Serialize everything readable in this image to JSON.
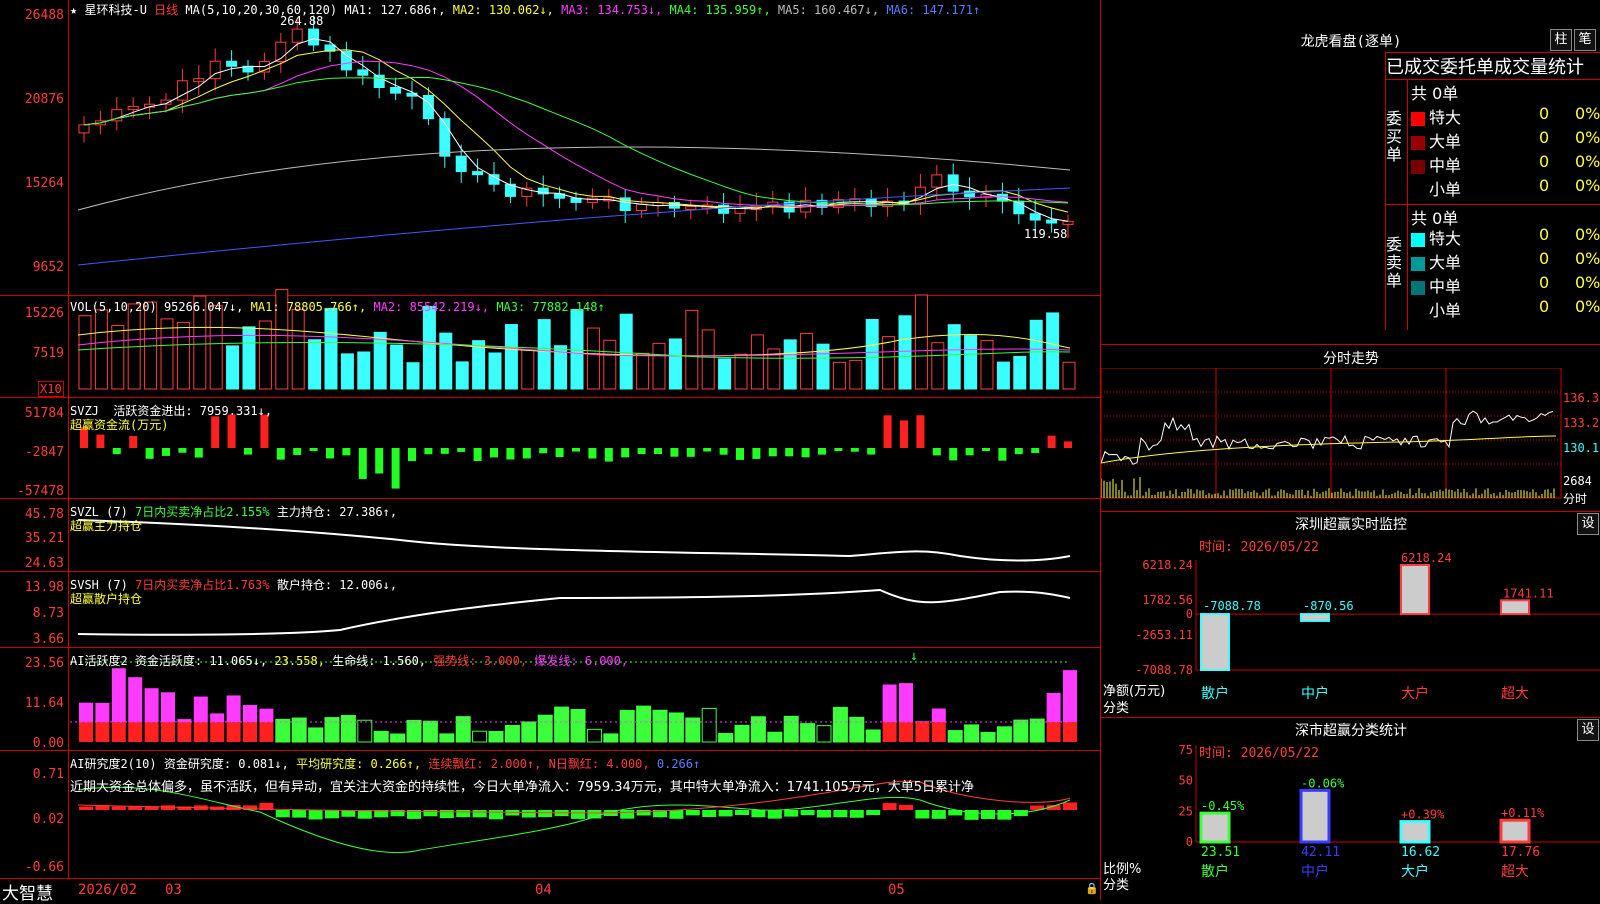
{
  "kline": {
    "title_star": "★",
    "stock_name": "星环科技-U",
    "period": "日线",
    "ma_params": "MA(5,10,20,30,60,120)",
    "ma1": "MA1: 127.686↑,",
    "ma2": "MA2: 130.062↓,",
    "ma3": "MA3: 134.753↓,",
    "ma4": "MA4: 135.959↑,",
    "ma5": "MA5: 160.467↓,",
    "ma6": "MA6: 147.171↑",
    "axis": [
      "26488",
      "20876",
      "15264",
      "9652"
    ],
    "high_label": "264.88",
    "low_label": "119.58"
  },
  "vol": {
    "params": "VOL(5,10,20)",
    "value": "95266.047↓,",
    "ma1": "MA1: 78805.766↑,",
    "ma2": "MA2: 85542.219↓,",
    "ma3": "MA3: 77882.148↑",
    "axis": [
      "15226",
      "7519"
    ],
    "unit": "X10"
  },
  "svzj": {
    "name": "SVZJ",
    "line1": "活跃资金进出: 7959.331↓,",
    "line2": "超赢资金流(万元)",
    "axis": [
      "51784",
      "-2847",
      "-57478"
    ]
  },
  "svzl": {
    "name": "SVZL (7)",
    "pct": "7日内买卖净占比2.155%",
    "hold": "主力持仓: 27.386↑,",
    "line2": "超赢主力持仓",
    "axis": [
      "45.78",
      "35.21",
      "24.63"
    ]
  },
  "svsh": {
    "name": "SVSH (7)",
    "pct": "7日内买卖净占比1.763%",
    "hold": "散户持仓: 12.006↓,",
    "line2": "超赢散户持仓",
    "axis": [
      "13.98",
      "8.73",
      "3.66"
    ]
  },
  "ai_active": {
    "name": "AI活跃度2",
    "v1": "资金活跃度: 11.065↓,",
    "v2": "23.558,",
    "v3": "生命线: 1.560,",
    "v4": "强势线: 3.000,",
    "v5": "爆发线: 6.000,",
    "axis": [
      "23.56",
      "11.64",
      "0.00"
    ]
  },
  "ai_research": {
    "name": "AI研究度2(10)",
    "v1": "资金研究度: 0.081↓,",
    "v2": "平均研究度: 0.266↑,",
    "v3": "连续飘红: 2.000↑,",
    "v4": "N日飘红: 4.000,",
    "v5": "0.266↑",
    "comment": "近期大资金总体偏多，虽不活跃，但有异动，宜关注大资金的持续性，今日大单净流入：7959.34万元，其中特大单净流入：1741.105万元，大单5日累计净",
    "axis": [
      "0.71",
      "0.02",
      "-0.66"
    ]
  },
  "bottom": {
    "brand": "大智慧",
    "dates": [
      "2026/02",
      "03",
      "04",
      "05"
    ]
  },
  "longhu": {
    "title": "龙虎看盘(逐单)",
    "btn1": "柱",
    "btn2": "笔",
    "header": "已成交委托单成交量统计",
    "buy_label": "委买单",
    "sell_label": "委卖单",
    "buy_total": "共 0单",
    "sell_total": "共 0单",
    "buy_rows": [
      {
        "name": "特大",
        "count": "0",
        "pct": "0%",
        "color": "#ff0000"
      },
      {
        "name": "大单",
        "count": "0",
        "pct": "0%",
        "color": "#990000"
      },
      {
        "name": "中单",
        "count": "0",
        "pct": "0%",
        "color": "#770000"
      },
      {
        "name": "小单",
        "count": "0",
        "pct": "0%",
        "color": "#000000"
      }
    ],
    "sell_rows": [
      {
        "name": "特大",
        "count": "0",
        "pct": "0%",
        "color": "#00ffff"
      },
      {
        "name": "大单",
        "count": "0",
        "pct": "0%",
        "color": "#009999"
      },
      {
        "name": "中单",
        "count": "0",
        "pct": "0%",
        "color": "#007777"
      },
      {
        "name": "小单",
        "count": "0",
        "pct": "0%",
        "color": "#000000"
      }
    ]
  },
  "intraday": {
    "title": "分时走势",
    "axis": [
      "136.3",
      "133.2",
      "130.1"
    ],
    "vol_label": "2684",
    "vol_unit": "分时"
  },
  "sz_monitor": {
    "title": "深圳超赢实时监控",
    "btn": "设",
    "time": "时间: 2026/05/22",
    "axis": [
      "6218.24",
      "1782.56",
      "0",
      "-2653.11",
      "-7088.78"
    ],
    "ylabel": "净额(万元)",
    "xlabel": "分类",
    "categories": [
      "散户",
      "中户",
      "大户",
      "超大"
    ],
    "values": [
      "-7088.78",
      "-870.56",
      "6218.24",
      "1741.11"
    ]
  },
  "sz_class": {
    "title": "深市超赢分类统计",
    "btn": "设",
    "time": "时间: 2026/05/22",
    "axis": [
      "75",
      "50",
      "25",
      "0"
    ],
    "ylabel": "比例%",
    "xlabel": "分类",
    "categories": [
      "散户",
      "中户",
      "大户",
      "超大"
    ],
    "values": [
      "23.51",
      "42.11",
      "16.62",
      "17.76"
    ],
    "changes": [
      "-0.45%",
      "-0.06%",
      "+0.39%",
      "+0.11%"
    ]
  },
  "chart_data": [
    {
      "type": "bar",
      "title": "深圳超赢实时监控",
      "categories": [
        "散户",
        "中户",
        "大户",
        "超大"
      ],
      "values": [
        -7088.78,
        -870.56,
        6218.24,
        1741.11
      ],
      "ylabel": "净额(万元)",
      "xlabel": "分类",
      "ylim": [
        -7088.78,
        6218.24
      ]
    },
    {
      "type": "bar",
      "title": "深市超赢分类统计",
      "categories": [
        "散户",
        "中户",
        "大户",
        "超大"
      ],
      "values": [
        23.51,
        42.11,
        16.62,
        17.76
      ],
      "changes": [
        "-0.45%",
        "-0.06%",
        "+0.39%",
        "+0.11%"
      ],
      "ylabel": "比例%",
      "xlabel": "分类",
      "ylim": [
        0,
        75
      ]
    }
  ],
  "colors": {
    "up": "#ff3b3b",
    "down": "#3bffff",
    "green": "#3bff3b",
    "grid": "#cc0000"
  }
}
